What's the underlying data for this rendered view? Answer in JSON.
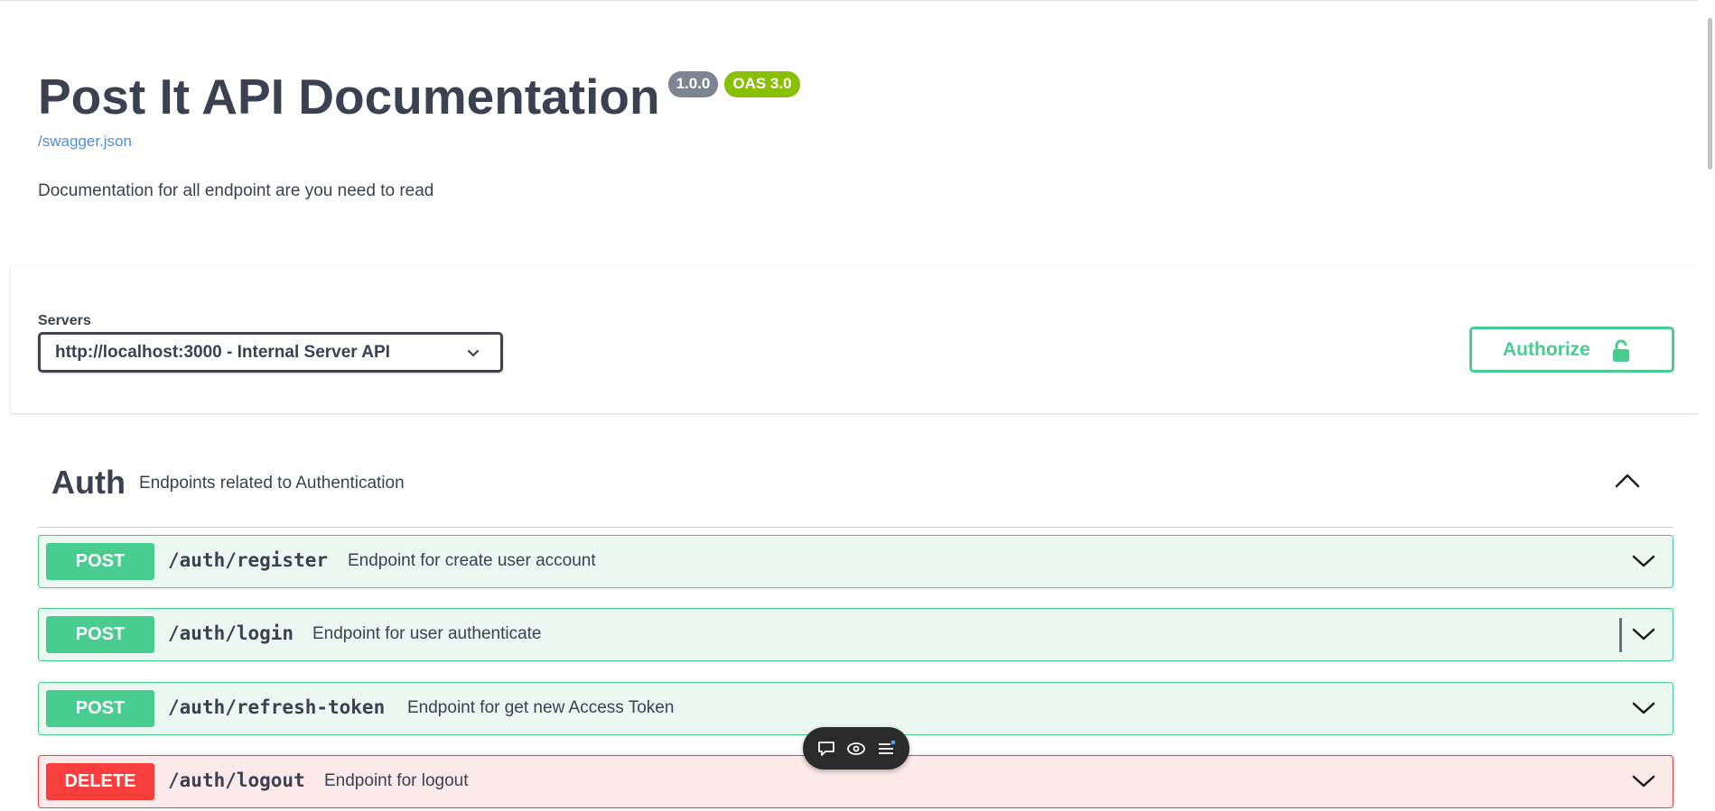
{
  "info": {
    "title": "Post It API Documentation",
    "version": "1.0.0",
    "oas_version": "OAS 3.0",
    "spec_link": "/swagger.json",
    "description": "Documentation for all endpoint are you need to read"
  },
  "servers": {
    "label": "Servers",
    "selected": "http://localhost:3000 - Internal Server API"
  },
  "authorize": {
    "label": "Authorize"
  },
  "tag": {
    "name": "Auth",
    "description": "Endpoints related to Authentication",
    "expanded": true
  },
  "operations": [
    {
      "method": "POST",
      "path": "/auth/register",
      "summary": "Endpoint for create user account"
    },
    {
      "method": "POST",
      "path": "/auth/login",
      "summary": "Endpoint for user authenticate"
    },
    {
      "method": "POST",
      "path": "/auth/refresh-token",
      "summary": "Endpoint for get new Access Token"
    },
    {
      "method": "DELETE",
      "path": "/auth/logout",
      "summary": "Endpoint for logout"
    }
  ],
  "colors": {
    "post": "#49cc90",
    "post_bg": "#ebf8f2",
    "delete": "#f93e3e",
    "delete_bg": "#fce9e9",
    "text": "#3b4151",
    "link": "#4990e2",
    "version_badge": "#7d8492",
    "oas_badge": "#89bf04"
  },
  "icons": {
    "servers_dropdown": "chevron-down-icon",
    "authorize": "unlock-icon",
    "tag_toggle": "chevron-up-icon",
    "operation_toggle": "chevron-down-icon",
    "toolbar": [
      "comment-icon",
      "eye-icon",
      "menu-icon"
    ]
  }
}
